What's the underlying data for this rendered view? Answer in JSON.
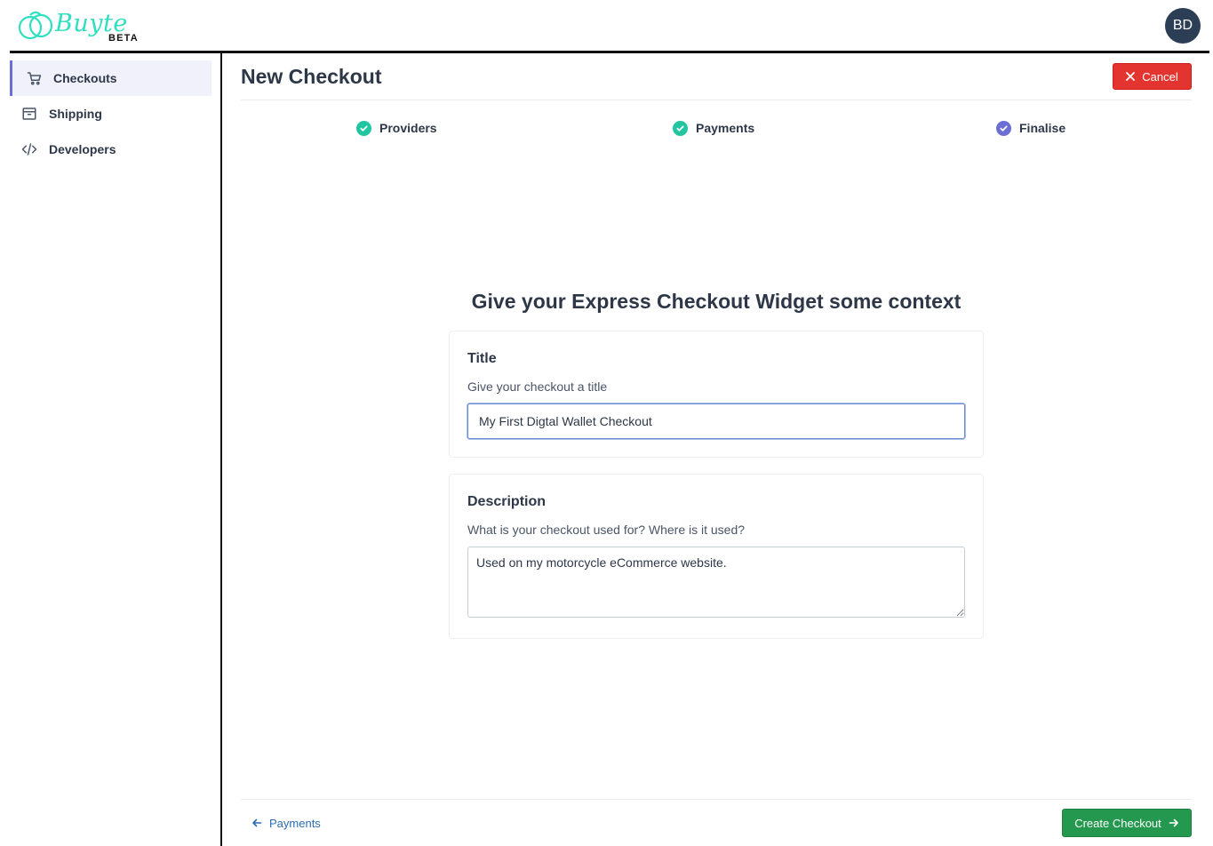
{
  "brand": {
    "name": "Buyte",
    "badge": "BETA",
    "accent": "#2ee0c0"
  },
  "user": {
    "initials": "BD"
  },
  "sidebar": {
    "items": [
      {
        "label": "Checkouts",
        "icon": "cart-icon",
        "active": true
      },
      {
        "label": "Shipping",
        "icon": "box-icon",
        "active": false
      },
      {
        "label": "Developers",
        "icon": "code-icon",
        "active": false
      }
    ]
  },
  "header": {
    "title": "New Checkout",
    "cancel_label": "Cancel"
  },
  "steps": [
    {
      "label": "Providers",
      "status": "complete",
      "color": "#21c6a0"
    },
    {
      "label": "Payments",
      "status": "complete",
      "color": "#21c6a0"
    },
    {
      "label": "Finalise",
      "status": "current",
      "color": "#6b6fd4"
    }
  ],
  "form": {
    "heading": "Give your Express Checkout Widget some context",
    "title": {
      "label": "Title",
      "help": "Give your checkout a title",
      "value": "My First Digtal Wallet Checkout"
    },
    "description": {
      "label": "Description",
      "help": "What is your checkout used for? Where is it used?",
      "value": "Used on my motorcycle eCommerce website."
    }
  },
  "footer": {
    "back_label": "Payments",
    "next_label": "Create Checkout"
  },
  "colors": {
    "cancel": "#e3342f",
    "create": "#24984e",
    "link": "#2b6cb0",
    "active_nav": "#6b6fd4"
  }
}
